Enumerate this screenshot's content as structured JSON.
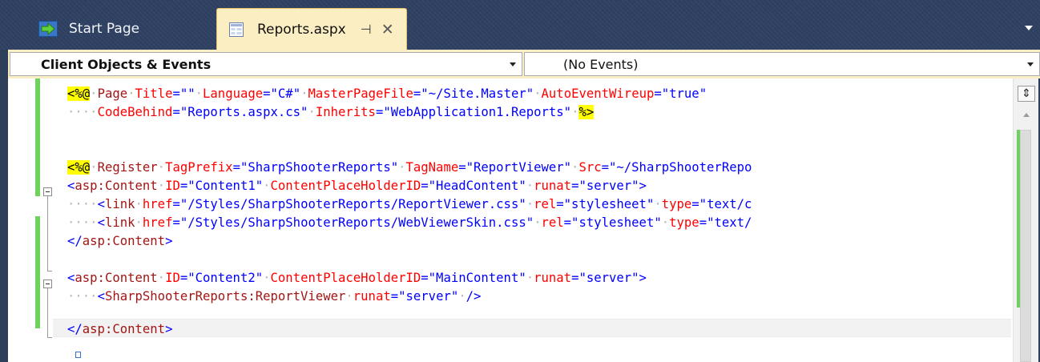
{
  "tabs": {
    "start": {
      "label": "Start Page",
      "icon": "start-page-arrow-icon"
    },
    "reports": {
      "label": "Reports.aspx",
      "icon": "aspx-document-icon",
      "pin_icon": "pin-icon",
      "close_icon": "close-icon",
      "pin_glyph": "⊣",
      "close_glyph": "✕"
    },
    "overflow_icon": "tab-overflow-chevron-icon"
  },
  "navigation": {
    "objects_value": "Client Objects & Events",
    "events_value": "(No Events)"
  },
  "editor": {
    "lines": [
      [
        {
          "t": "<%@",
          "c": "k-hl"
        },
        {
          "t": "·",
          "c": "k-ws"
        },
        {
          "t": "Page",
          "c": "k-tag"
        },
        {
          "t": "·",
          "c": "k-ws"
        },
        {
          "t": "Title",
          "c": "k-attr"
        },
        {
          "t": "=\"\"",
          "c": "k-str"
        },
        {
          "t": "·",
          "c": "k-ws"
        },
        {
          "t": "Language",
          "c": "k-attr"
        },
        {
          "t": "=\"C#\"",
          "c": "k-str"
        },
        {
          "t": "·",
          "c": "k-ws"
        },
        {
          "t": "MasterPageFile",
          "c": "k-attr"
        },
        {
          "t": "=\"~/Site.Master\"",
          "c": "k-str"
        },
        {
          "t": "·",
          "c": "k-ws"
        },
        {
          "t": "AutoEventWireup",
          "c": "k-attr"
        },
        {
          "t": "=\"true\"",
          "c": "k-str"
        }
      ],
      [
        {
          "t": "····",
          "c": "k-ws"
        },
        {
          "t": "CodeBehind",
          "c": "k-attr"
        },
        {
          "t": "=\"Reports.aspx.cs\"",
          "c": "k-str"
        },
        {
          "t": "·",
          "c": "k-ws"
        },
        {
          "t": "Inherits",
          "c": "k-attr"
        },
        {
          "t": "=\"WebApplication1.Reports\"",
          "c": "k-str"
        },
        {
          "t": "·",
          "c": "k-ws"
        },
        {
          "t": "%>",
          "c": "k-hl"
        }
      ],
      [],
      [
        {
          "t": "<%@",
          "c": "k-hl"
        },
        {
          "t": "·",
          "c": "k-ws"
        },
        {
          "t": "Register",
          "c": "k-tag"
        },
        {
          "t": "·",
          "c": "k-ws"
        },
        {
          "t": "TagPrefix",
          "c": "k-attr"
        },
        {
          "t": "=\"SharpShooterReports\"",
          "c": "k-str"
        },
        {
          "t": "·",
          "c": "k-ws"
        },
        {
          "t": "TagName",
          "c": "k-attr"
        },
        {
          "t": "=\"ReportViewer\"",
          "c": "k-str"
        },
        {
          "t": "·",
          "c": "k-ws"
        },
        {
          "t": "Src",
          "c": "k-attr"
        },
        {
          "t": "=\"~/SharpShooterRepo",
          "c": "k-str"
        }
      ],
      [
        {
          "t": "<",
          "c": "k-punc"
        },
        {
          "t": "asp:Content",
          "c": "k-tag"
        },
        {
          "t": "·",
          "c": "k-ws"
        },
        {
          "t": "ID",
          "c": "k-attr"
        },
        {
          "t": "=\"Content1\"",
          "c": "k-str"
        },
        {
          "t": "·",
          "c": "k-ws"
        },
        {
          "t": "ContentPlaceHolderID",
          "c": "k-attr"
        },
        {
          "t": "=\"HeadContent\"",
          "c": "k-str"
        },
        {
          "t": "·",
          "c": "k-ws"
        },
        {
          "t": "runat",
          "c": "k-attr"
        },
        {
          "t": "=\"server\">",
          "c": "k-str"
        }
      ],
      [
        {
          "t": "····",
          "c": "k-ws"
        },
        {
          "t": "<",
          "c": "k-punc"
        },
        {
          "t": "link",
          "c": "k-tag"
        },
        {
          "t": "·",
          "c": "k-ws"
        },
        {
          "t": "href",
          "c": "k-attr"
        },
        {
          "t": "=\"/Styles/SharpShooterReports/ReportViewer.css\"",
          "c": "k-str"
        },
        {
          "t": "·",
          "c": "k-ws"
        },
        {
          "t": "rel",
          "c": "k-attr"
        },
        {
          "t": "=\"stylesheet\"",
          "c": "k-str"
        },
        {
          "t": "·",
          "c": "k-ws"
        },
        {
          "t": "type",
          "c": "k-attr"
        },
        {
          "t": "=\"text/c",
          "c": "k-str"
        }
      ],
      [
        {
          "t": "····",
          "c": "k-ws"
        },
        {
          "t": "<",
          "c": "k-punc"
        },
        {
          "t": "link",
          "c": "k-tag"
        },
        {
          "t": "·",
          "c": "k-ws"
        },
        {
          "t": "href",
          "c": "k-attr"
        },
        {
          "t": "=\"/Styles/SharpShooterReports/WebViewerSkin.css\"",
          "c": "k-str"
        },
        {
          "t": "·",
          "c": "k-ws"
        },
        {
          "t": "rel",
          "c": "k-attr"
        },
        {
          "t": "=\"stylesheet\"",
          "c": "k-str"
        },
        {
          "t": "·",
          "c": "k-ws"
        },
        {
          "t": "type",
          "c": "k-attr"
        },
        {
          "t": "=\"text/",
          "c": "k-str"
        }
      ],
      [
        {
          "t": "</",
          "c": "k-punc"
        },
        {
          "t": "asp:Content",
          "c": "k-tag"
        },
        {
          "t": ">",
          "c": "k-punc"
        }
      ],
      [
        {
          "t": "<",
          "c": "k-punc"
        },
        {
          "t": "asp:Content",
          "c": "k-tag"
        },
        {
          "t": "·",
          "c": "k-ws"
        },
        {
          "t": "ID",
          "c": "k-attr"
        },
        {
          "t": "=\"Content2\"",
          "c": "k-str"
        },
        {
          "t": "·",
          "c": "k-ws"
        },
        {
          "t": "ContentPlaceHolderID",
          "c": "k-attr"
        },
        {
          "t": "=\"MainContent\"",
          "c": "k-str"
        },
        {
          "t": "·",
          "c": "k-ws"
        },
        {
          "t": "runat",
          "c": "k-attr"
        },
        {
          "t": "=\"server\">",
          "c": "k-str"
        }
      ],
      [
        {
          "t": "····",
          "c": "k-ws"
        },
        {
          "t": "<",
          "c": "k-punc"
        },
        {
          "t": "SharpShooterReports:ReportViewer",
          "c": "k-tag"
        },
        {
          "t": "·",
          "c": "k-ws"
        },
        {
          "t": "runat",
          "c": "k-attr"
        },
        {
          "t": "=\"server\"",
          "c": "k-str"
        },
        {
          "t": "·",
          "c": "k-ws"
        },
        {
          "t": "/>",
          "c": "k-punc"
        }
      ],
      [
        {
          "t": "</",
          "c": "k-punc"
        },
        {
          "t": "asp:Content",
          "c": "k-tag"
        },
        {
          "t": ">",
          "c": "k-punc"
        }
      ],
      []
    ],
    "scrollbar": {
      "split_glyph": "⇕",
      "split_icon": "splitter-icon",
      "up_icon": "scroll-up-arrow-icon"
    }
  },
  "colors": {
    "tab_active_bg": "#fbeec2",
    "tab_strip_bg": "#2f4163",
    "change_marker": "#6fd25c",
    "directive_highlight": "#ffff00"
  }
}
